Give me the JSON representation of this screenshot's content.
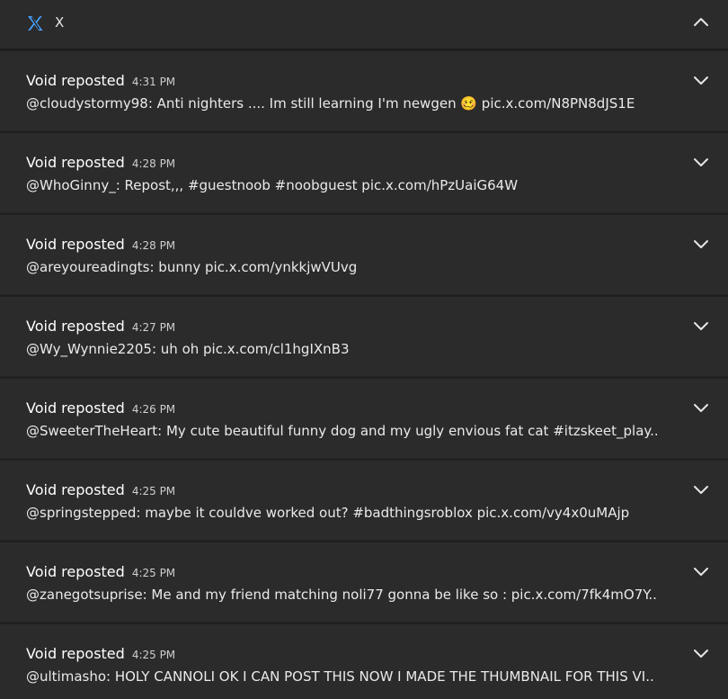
{
  "header": {
    "app_name": "X",
    "app_icon": "x-logo-icon",
    "collapse_icon": "chevron-up-icon"
  },
  "notifications": [
    {
      "title": "Void reposted",
      "time": "4:31 PM",
      "body": "@cloudystormy98: Anti nighters .... Im still learning I'm newgen 🥴 pic.x.com/N8PN8dJS1E"
    },
    {
      "title": "Void reposted",
      "time": "4:28 PM",
      "body": "@WhoGinny_: Repost,,, #guestnoob #noobguest pic.x.com/hPzUaiG64W"
    },
    {
      "title": "Void reposted",
      "time": "4:28 PM",
      "body": "@areyoureadingts: bunny pic.x.com/ynkkjwVUvg"
    },
    {
      "title": "Void reposted",
      "time": "4:27 PM",
      "body": "@Wy_Wynnie2205: uh oh pic.x.com/cl1hgIXnB3"
    },
    {
      "title": "Void reposted",
      "time": "4:26 PM",
      "body": "@SweeterTheHeart: My cute beautiful funny dog and my ugly envious fat cat #itzskeet_play.."
    },
    {
      "title": "Void reposted",
      "time": "4:25 PM",
      "body": "@springstepped: maybe it couldve worked out? #badthingsroblox pic.x.com/vy4x0uMAjp"
    },
    {
      "title": "Void reposted",
      "time": "4:25 PM",
      "body": "@zanegotsuprise: Me and my friend matching noli77 gonna be like so : pic.x.com/7fk4mO7Y.."
    },
    {
      "title": "Void reposted",
      "time": "4:25 PM",
      "body": "@ultimasho: HOLY CANNOLI OK I CAN POST THIS NOW I MADE THE THUMBNAIL FOR THIS VI.."
    }
  ],
  "expand_icon": "chevron-down-icon",
  "colors": {
    "background": "#202020",
    "card": "#2b2b2b",
    "logo": "#4aa3ff"
  }
}
